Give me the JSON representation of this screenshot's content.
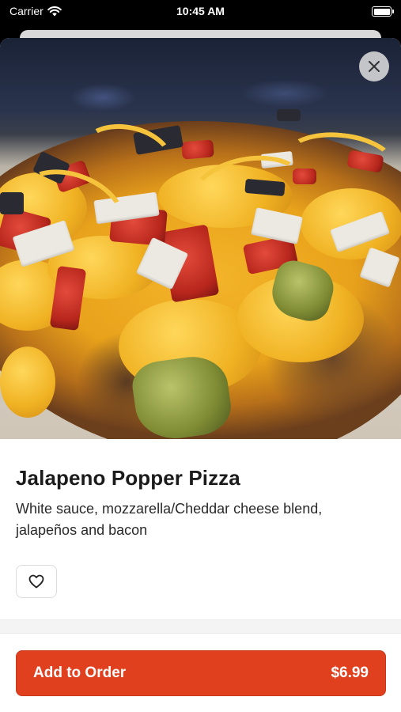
{
  "status_bar": {
    "carrier": "Carrier",
    "time": "10:45 AM"
  },
  "item": {
    "name": "Jalapeno Popper Pizza",
    "description": "White sauce, mozzarella/Cheddar cheese blend, jalapeños and bacon",
    "image": "pizza-photo"
  },
  "icons": {
    "close": "close-icon",
    "favorite": "heart-outline-icon",
    "wifi": "wifi-icon",
    "battery": "battery-icon"
  },
  "order_button": {
    "label": "Add to Order",
    "price": "$6.99"
  },
  "colors": {
    "accent": "#e0401e",
    "background": "#ffffff"
  }
}
